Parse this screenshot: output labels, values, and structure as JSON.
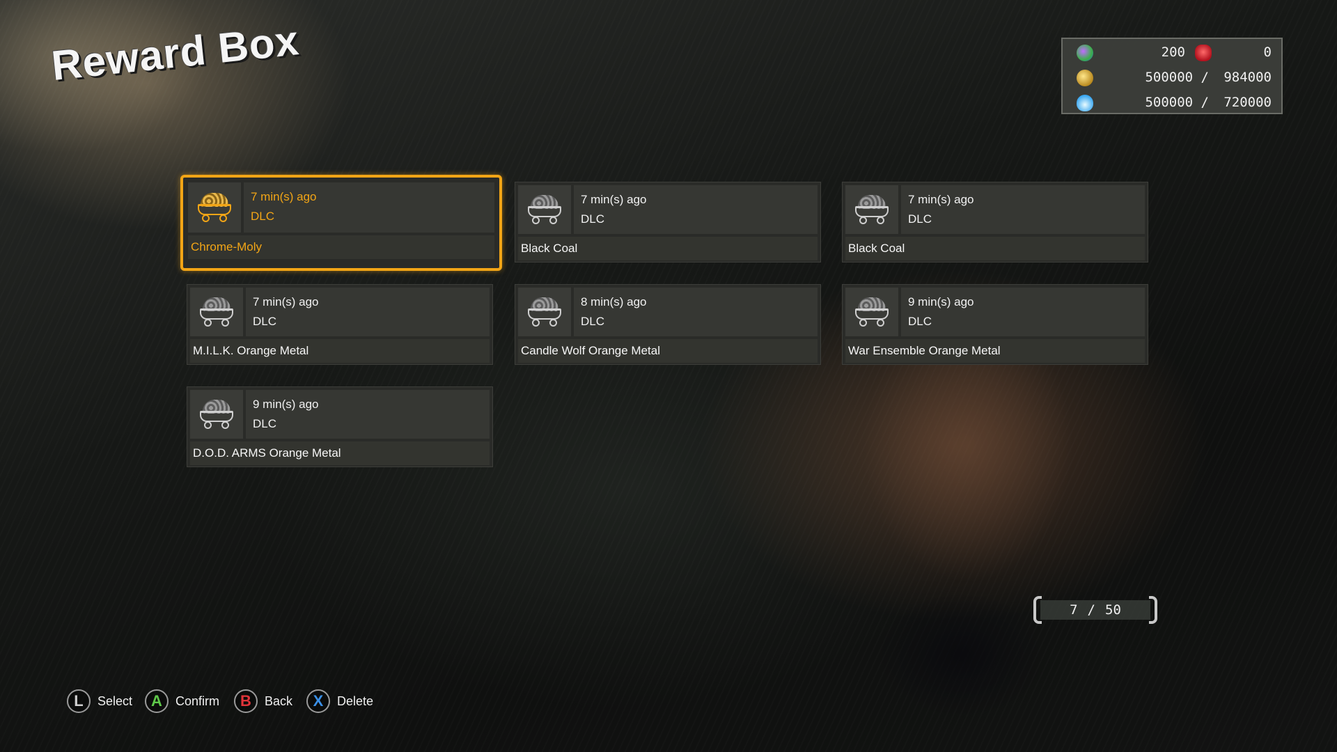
{
  "title": "Reward Box",
  "resources": {
    "gems": "200",
    "skulls": "0",
    "coins": {
      "current": "500000",
      "max": "984000"
    },
    "souls": {
      "current": "500000",
      "max": "720000"
    },
    "icons": [
      "gem-icon",
      "skull-icon",
      "coin-icon",
      "flame-icon"
    ]
  },
  "rewards": [
    {
      "time": "7 min(s) ago",
      "source": "DLC",
      "name": "Chrome-Moly",
      "selected": true
    },
    {
      "time": "7 min(s) ago",
      "source": "DLC",
      "name": "Black Coal"
    },
    {
      "time": "7 min(s) ago",
      "source": "DLC",
      "name": "Black Coal"
    },
    {
      "time": "7 min(s) ago",
      "source": "DLC",
      "name": "M.I.L.K. Orange Metal"
    },
    {
      "time": "8 min(s) ago",
      "source": "DLC",
      "name": "Candle Wolf Orange Metal"
    },
    {
      "time": "9 min(s) ago",
      "source": "DLC",
      "name": "War Ensemble Orange Metal"
    },
    {
      "time": "9 min(s) ago",
      "source": "DLC",
      "name": "D.O.D. ARMS Orange Metal"
    }
  ],
  "counter": {
    "current": "7",
    "separator": "/",
    "total": "50"
  },
  "prompts": [
    {
      "key": "L",
      "label": "Select",
      "color": "#cfcfcf"
    },
    {
      "key": "A",
      "label": "Confirm",
      "color": "#5fc84a"
    },
    {
      "key": "B",
      "label": "Back",
      "color": "#e0343a"
    },
    {
      "key": "X",
      "label": "Delete",
      "color": "#3a8fe6"
    }
  ],
  "colors": {
    "highlight": "#f2a516"
  }
}
